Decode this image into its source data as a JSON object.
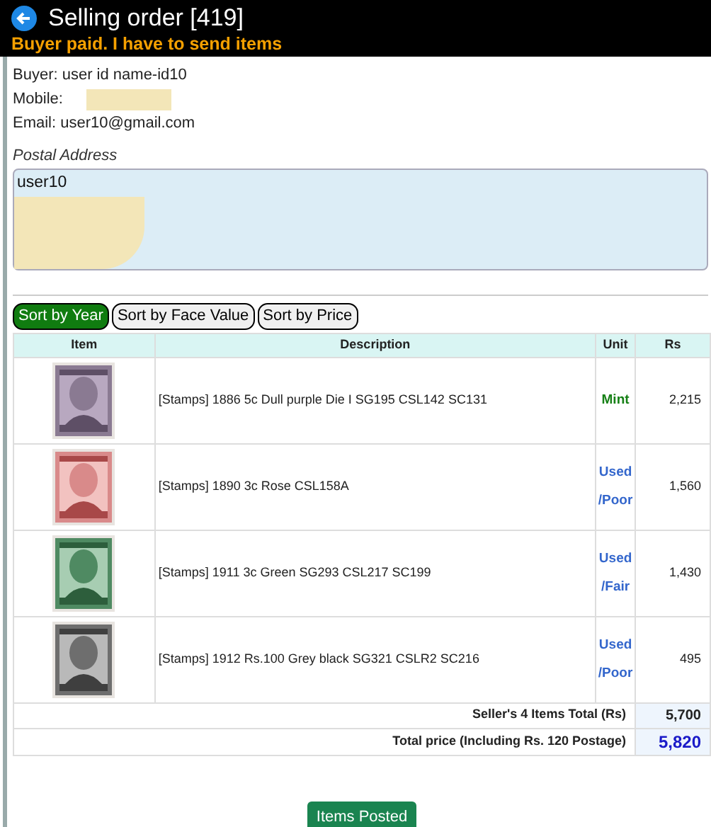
{
  "header": {
    "title": "Selling order [419]",
    "status": "Buyer paid. I have to send items"
  },
  "buyer": {
    "buyer": "Buyer: user id name-id10",
    "mobile": "Mobile:",
    "email": "Email: user10@gmail.com"
  },
  "postal_address": {
    "label": "Postal Address",
    "value": "user10"
  },
  "sort_buttons": [
    {
      "label": "Sort by Year",
      "selected": true
    },
    {
      "label": "Sort by Face Value",
      "selected": false
    },
    {
      "label": "Sort by Price",
      "selected": false
    }
  ],
  "table": {
    "columns": [
      "Item",
      "Description",
      "Unit",
      "Rs"
    ],
    "rows": [
      {
        "description": "[Stamps] 1886 5c Dull purple Die I SG195 CSL142 SC131",
        "unit": "Mint",
        "color": "#168016",
        "rs": "2,215"
      },
      {
        "description": "[Stamps] 1890 3c Rose CSL158A",
        "unit": "Used /Poor",
        "color": "#3366cc",
        "rs": "1,560"
      },
      {
        "description": "[Stamps] 1911 3c Green SG293 CSL217 SC199",
        "unit": "Used /Fair",
        "color": "#3366cc",
        "rs": "1,430"
      },
      {
        "description": "[Stamps] 1912 Rs.100 Grey black SG321 CSLR2 SC216",
        "unit": "Used /Poor",
        "color": "#3366cc",
        "rs": "495"
      }
    ],
    "totals": [
      {
        "label": "Seller's 4 Items Total (Rs)",
        "value": "5,700",
        "kind": "subtotal"
      },
      {
        "label": "Total price (Including Rs. 120 Postage)",
        "value": "5,820",
        "kind": "grand"
      }
    ]
  },
  "action_button": {
    "label": "Items Posted"
  }
}
